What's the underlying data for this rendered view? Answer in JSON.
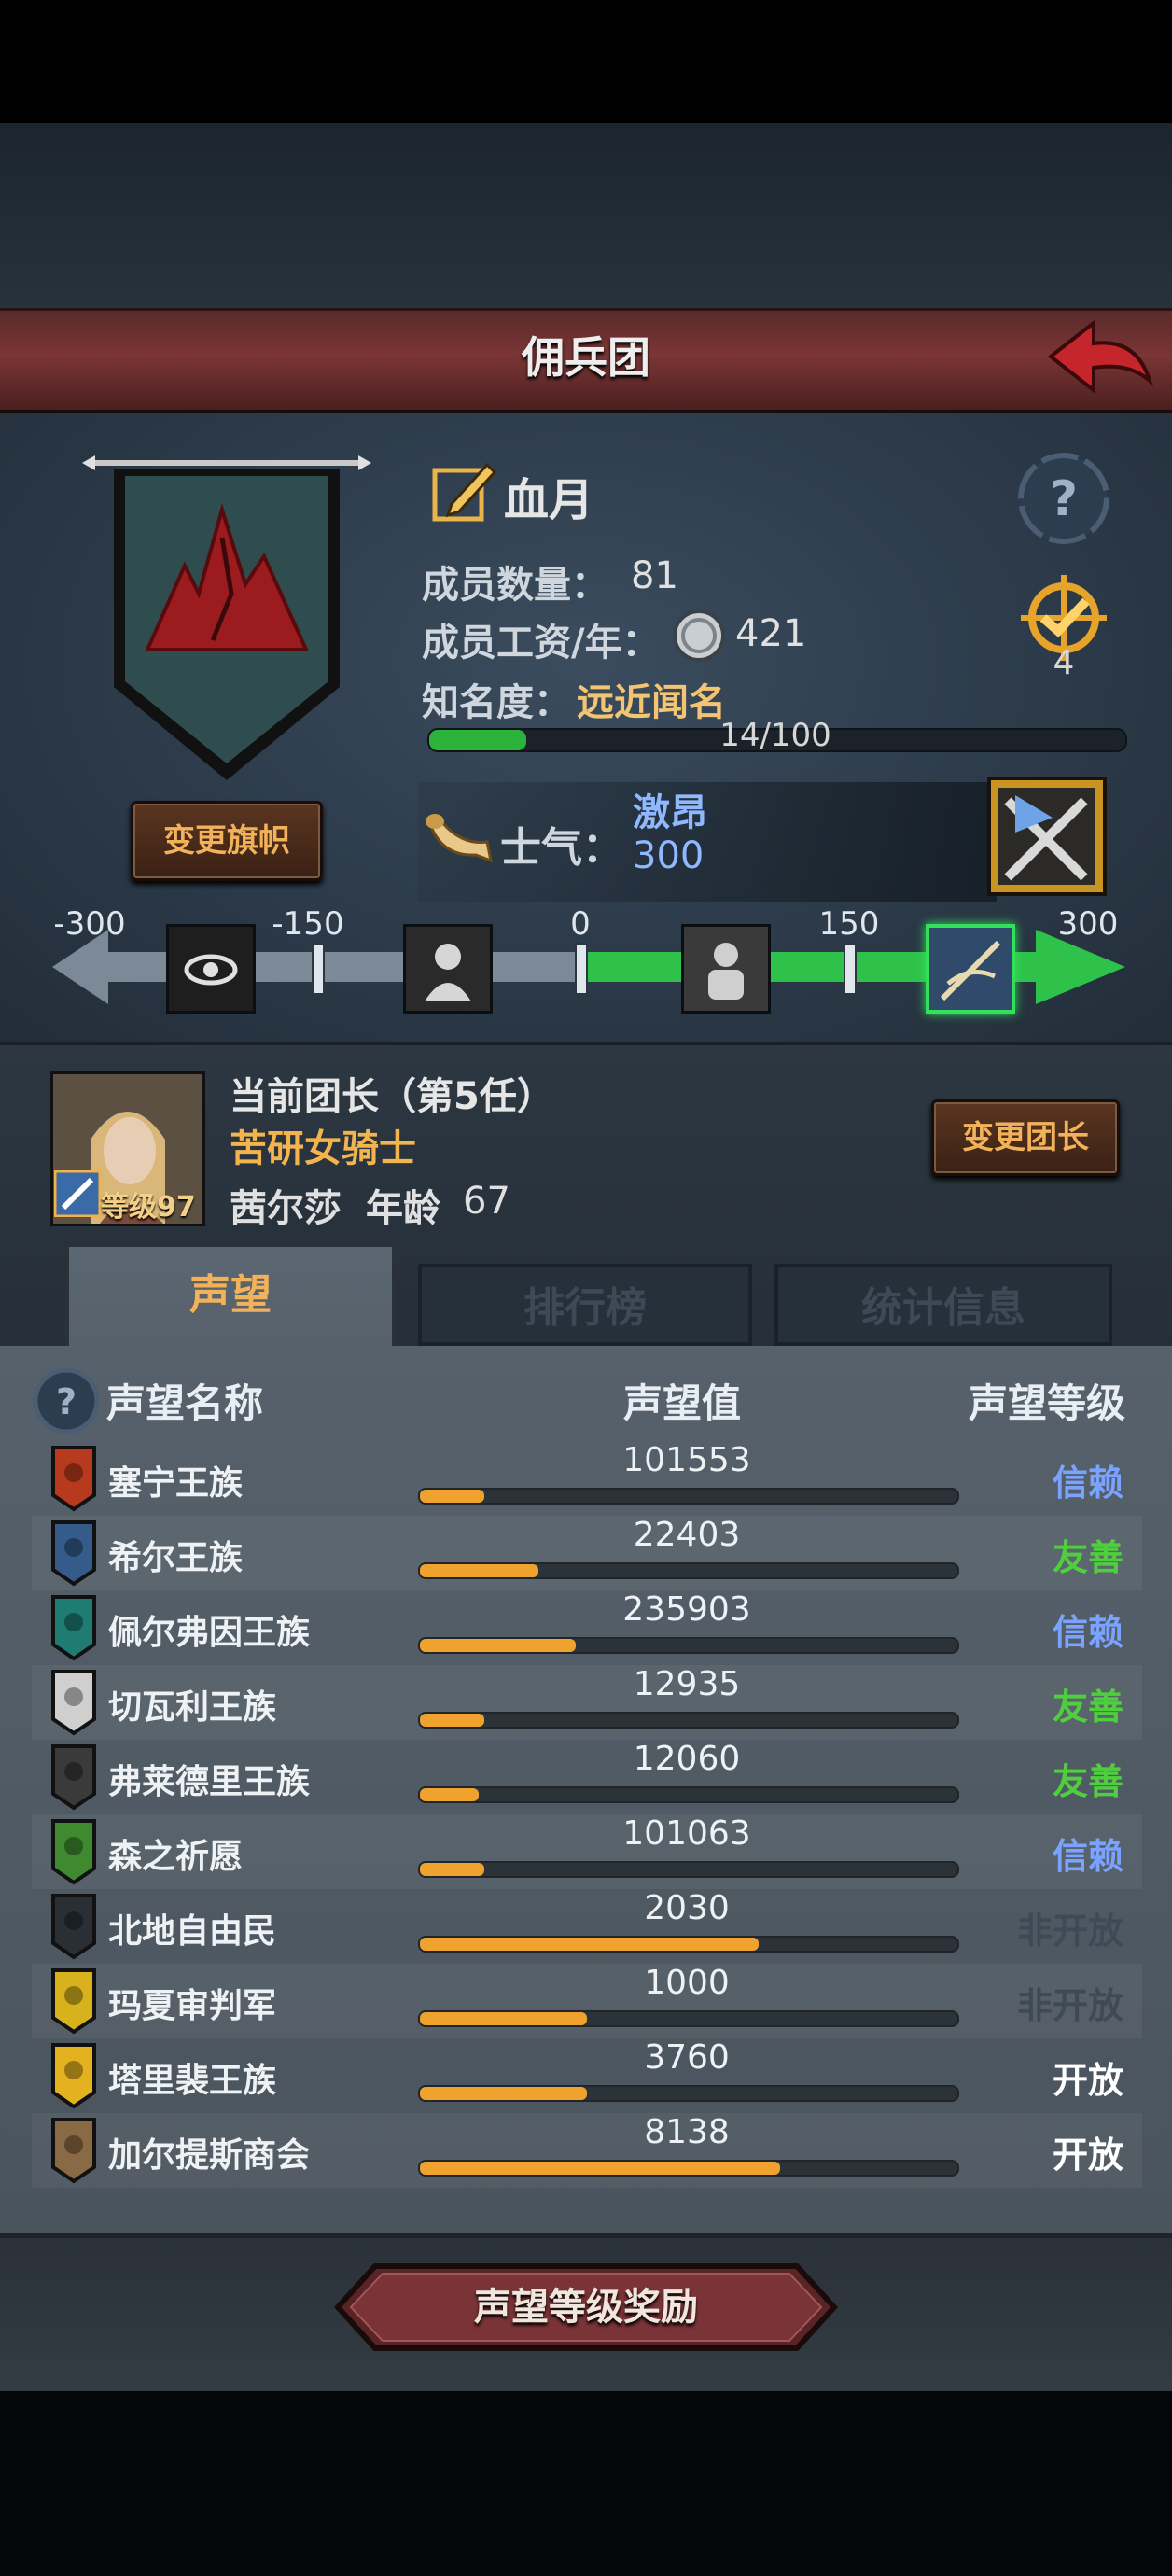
{
  "header": {
    "title": "佣兵团"
  },
  "band": {
    "name": "血月",
    "member_count_label": "成员数量：",
    "member_count": "81",
    "salary_label": "成员工资/年：",
    "salary": "421",
    "fame_label": "知名度：",
    "fame_value": "远近闻名",
    "fame_progress_text": "14/100",
    "fame_progress_fraction": 0.14,
    "change_banner_label": "变更旗帜",
    "badge_count": "4"
  },
  "morale": {
    "label": "士气：",
    "state": "激昂",
    "value": "300",
    "ticks": [
      "-300",
      "-150",
      "0",
      "150",
      "300"
    ]
  },
  "leader": {
    "title": "当前团长（第5任）",
    "class": "苦研女骑士",
    "name": "茜尔莎",
    "age_label": "年龄",
    "age": "67",
    "level": "等级97",
    "change_leader_label": "变更团长"
  },
  "tabs": [
    {
      "label": "声望",
      "active": true
    },
    {
      "label": "排行榜",
      "active": false
    },
    {
      "label": "统计信息",
      "active": false
    }
  ],
  "list_headers": {
    "name": "声望名称",
    "value": "声望值",
    "level": "声望等级"
  },
  "reputation": [
    {
      "name": "塞宁王族",
      "value": "101553",
      "progress": 0.12,
      "level": "信赖",
      "color": "#7aa3ff",
      "emblem": "#b83a1e"
    },
    {
      "name": "希尔王族",
      "value": "22403",
      "progress": 0.22,
      "level": "友善",
      "color": "#4fcf3e",
      "emblem": "#355b8a"
    },
    {
      "name": "佩尔弗因王族",
      "value": "235903",
      "progress": 0.29,
      "level": "信赖",
      "color": "#7aa3ff",
      "emblem": "#1f7c73"
    },
    {
      "name": "切瓦利王族",
      "value": "12935",
      "progress": 0.12,
      "level": "友善",
      "color": "#4fcf3e",
      "emblem": "#cfcfcf"
    },
    {
      "name": "弗莱德里王族",
      "value": "12060",
      "progress": 0.11,
      "level": "友善",
      "color": "#4fcf3e",
      "emblem": "#3a3a3a"
    },
    {
      "name": "森之祈愿",
      "value": "101063",
      "progress": 0.12,
      "level": "信赖",
      "color": "#7aa3ff",
      "emblem": "#3f8a2e"
    },
    {
      "name": "北地自由民",
      "value": "2030",
      "progress": 0.63,
      "level": "非开放",
      "color": "#3f4a56",
      "emblem": "#2a2f36"
    },
    {
      "name": "玛夏审判军",
      "value": "1000",
      "progress": 0.31,
      "level": "非开放",
      "color": "#3f4a56",
      "emblem": "#d8b21c"
    },
    {
      "name": "塔里裴王族",
      "value": "3760",
      "progress": 0.31,
      "level": "开放",
      "color": "#ffffff",
      "emblem": "#e3b21e"
    },
    {
      "name": "加尔提斯商会",
      "value": "8138",
      "progress": 0.67,
      "level": "开放",
      "color": "#ffffff",
      "emblem": "#8a6a44"
    }
  ],
  "reward_button": {
    "label": "声望等级奖励"
  },
  "icons": {
    "back": "back-arrow-icon",
    "help": "question-icon",
    "edit": "edit-pen-icon",
    "coin": "silver-coin-icon",
    "badge": "target-badge-icon",
    "horn": "horn-icon"
  }
}
